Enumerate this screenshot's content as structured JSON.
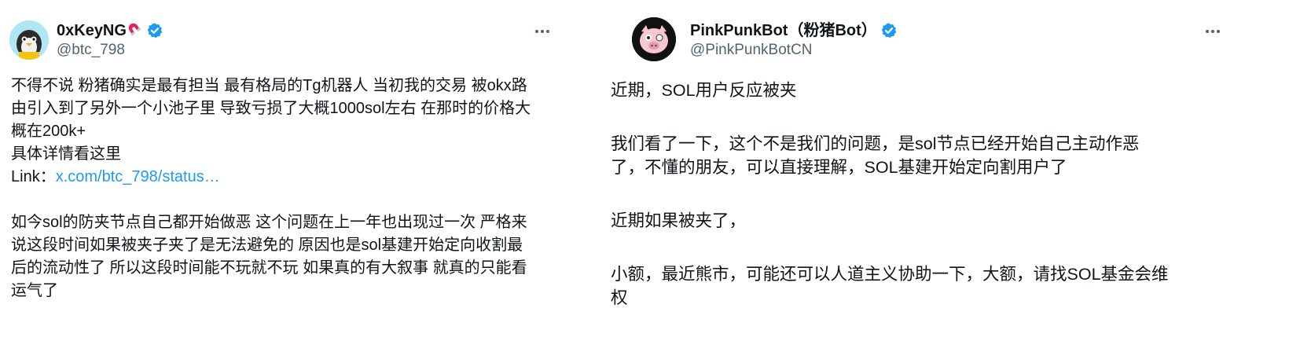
{
  "posts": [
    {
      "display_name": "0xKeyNG",
      "handle": "@btc_798",
      "emoji_icon": "magnet-icon",
      "verified_icon": "verified-badge-icon",
      "more_icon": "more-options-icon",
      "lines": [
        "不得不说 粉猪确实是最有担当 最有格局的Tg机器人 当初我的交易 被okx路",
        "由引入到了另外一个小池子里 导致亏损了大概1000sol左右 在那时的价格大",
        "概在200k+",
        "具体详情看这里",
        "",
        "",
        "如今sol的防夹节点自己都开始做恶 这个问题在上一年也出现过一次 严格来",
        "说这段时间如果被夹子夹了是无法避免的 原因也是sol基建开始定向收割最",
        "后的流动性了 所以这段时间能不玩就不玩 如果真的有大叙事 就真的只能看",
        "运气了"
      ],
      "link_label": "Link：",
      "link_text": "x.com/btc_798/status…"
    },
    {
      "display_name": "PinkPunkBot（粉猪Bot）",
      "handle": "@PinkPunkBotCN",
      "verified_icon": "verified-badge-icon",
      "more_icon": "more-options-icon",
      "lines": [
        "近期，SOL用户反应被夹",
        "",
        "我们看了一下，这个不是我们的问题，是sol节点已经开始自己主动作恶",
        "了，不懂的朋友，可以直接理解，SOL基建开始定向割用户了",
        "",
        "近期如果被夹了，",
        "",
        "小额，最近熊市，可能还可以人道主义协助一下，大额，请找SOL基金会维",
        "权"
      ]
    }
  ],
  "colors": {
    "text": "#0f1419",
    "secondary": "#536471",
    "link": "#1d9bf0",
    "verified": "#1d9bf0"
  }
}
